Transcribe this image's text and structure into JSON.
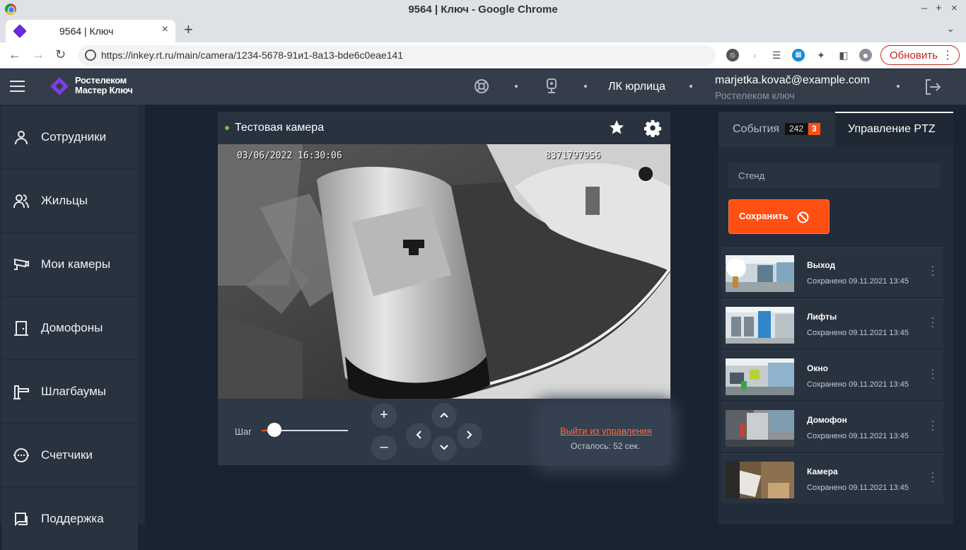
{
  "browser": {
    "window_title": "9564 | Ключ - Google Chrome",
    "tab_title": "9564 | Ключ",
    "url": "https://inkey.rt.ru/main/camera/1234-5678-91и1-8a13-bde6c0eae141",
    "update_label": "Обновить"
  },
  "header": {
    "logo_line1": "Ростелеком",
    "logo_line2": "Мастер Ключ",
    "org": "ЛК юрлица",
    "email": "marjetka.kovač@example.com",
    "company": "Ростелеком ключ"
  },
  "sidebar": {
    "items": [
      {
        "label": "Сотрудники",
        "icon": "person-icon"
      },
      {
        "label": "Жильцы",
        "icon": "people-icon"
      },
      {
        "label": "Мои камеры",
        "icon": "camera-icon"
      },
      {
        "label": "Домофоны",
        "icon": "door-icon"
      },
      {
        "label": "Шлагбаумы",
        "icon": "barrier-icon"
      },
      {
        "label": "Счетчики",
        "icon": "meter-icon"
      },
      {
        "label": "Поддержка",
        "icon": "support-icon"
      }
    ]
  },
  "camera": {
    "title": "Тестовая камера",
    "osd_datetime": "03/06/2022 16:30:06",
    "osd_id": "8371797956",
    "step_label": "Шаг",
    "step_value": 0.15,
    "exit_label": "Выйти из управления",
    "remaining": "Осталось: 52 сек."
  },
  "right_panel": {
    "tab_events": "События",
    "events_count": "242",
    "events_badge": "3",
    "tab_ptz": "Управление PTZ",
    "preset_placeholder": "Стенд",
    "save_label": "Сохранить",
    "presets": [
      {
        "name": "Выход",
        "saved": "Сохранено 09.11.2021 13:45"
      },
      {
        "name": "Лифты",
        "saved": "Сохранено 09.11.2021 13:45"
      },
      {
        "name": "Окно",
        "saved": "Сохранено 09.11.2021 13:45"
      },
      {
        "name": "Домофон",
        "saved": "Сохранено 09.11.2021 13:45"
      },
      {
        "name": "Камера",
        "saved": "Сохранено 09.11.2021 13:45"
      }
    ]
  },
  "colors": {
    "accent": "#ff4f12",
    "online": "#6cc04a",
    "link": "#ff6a3d"
  }
}
